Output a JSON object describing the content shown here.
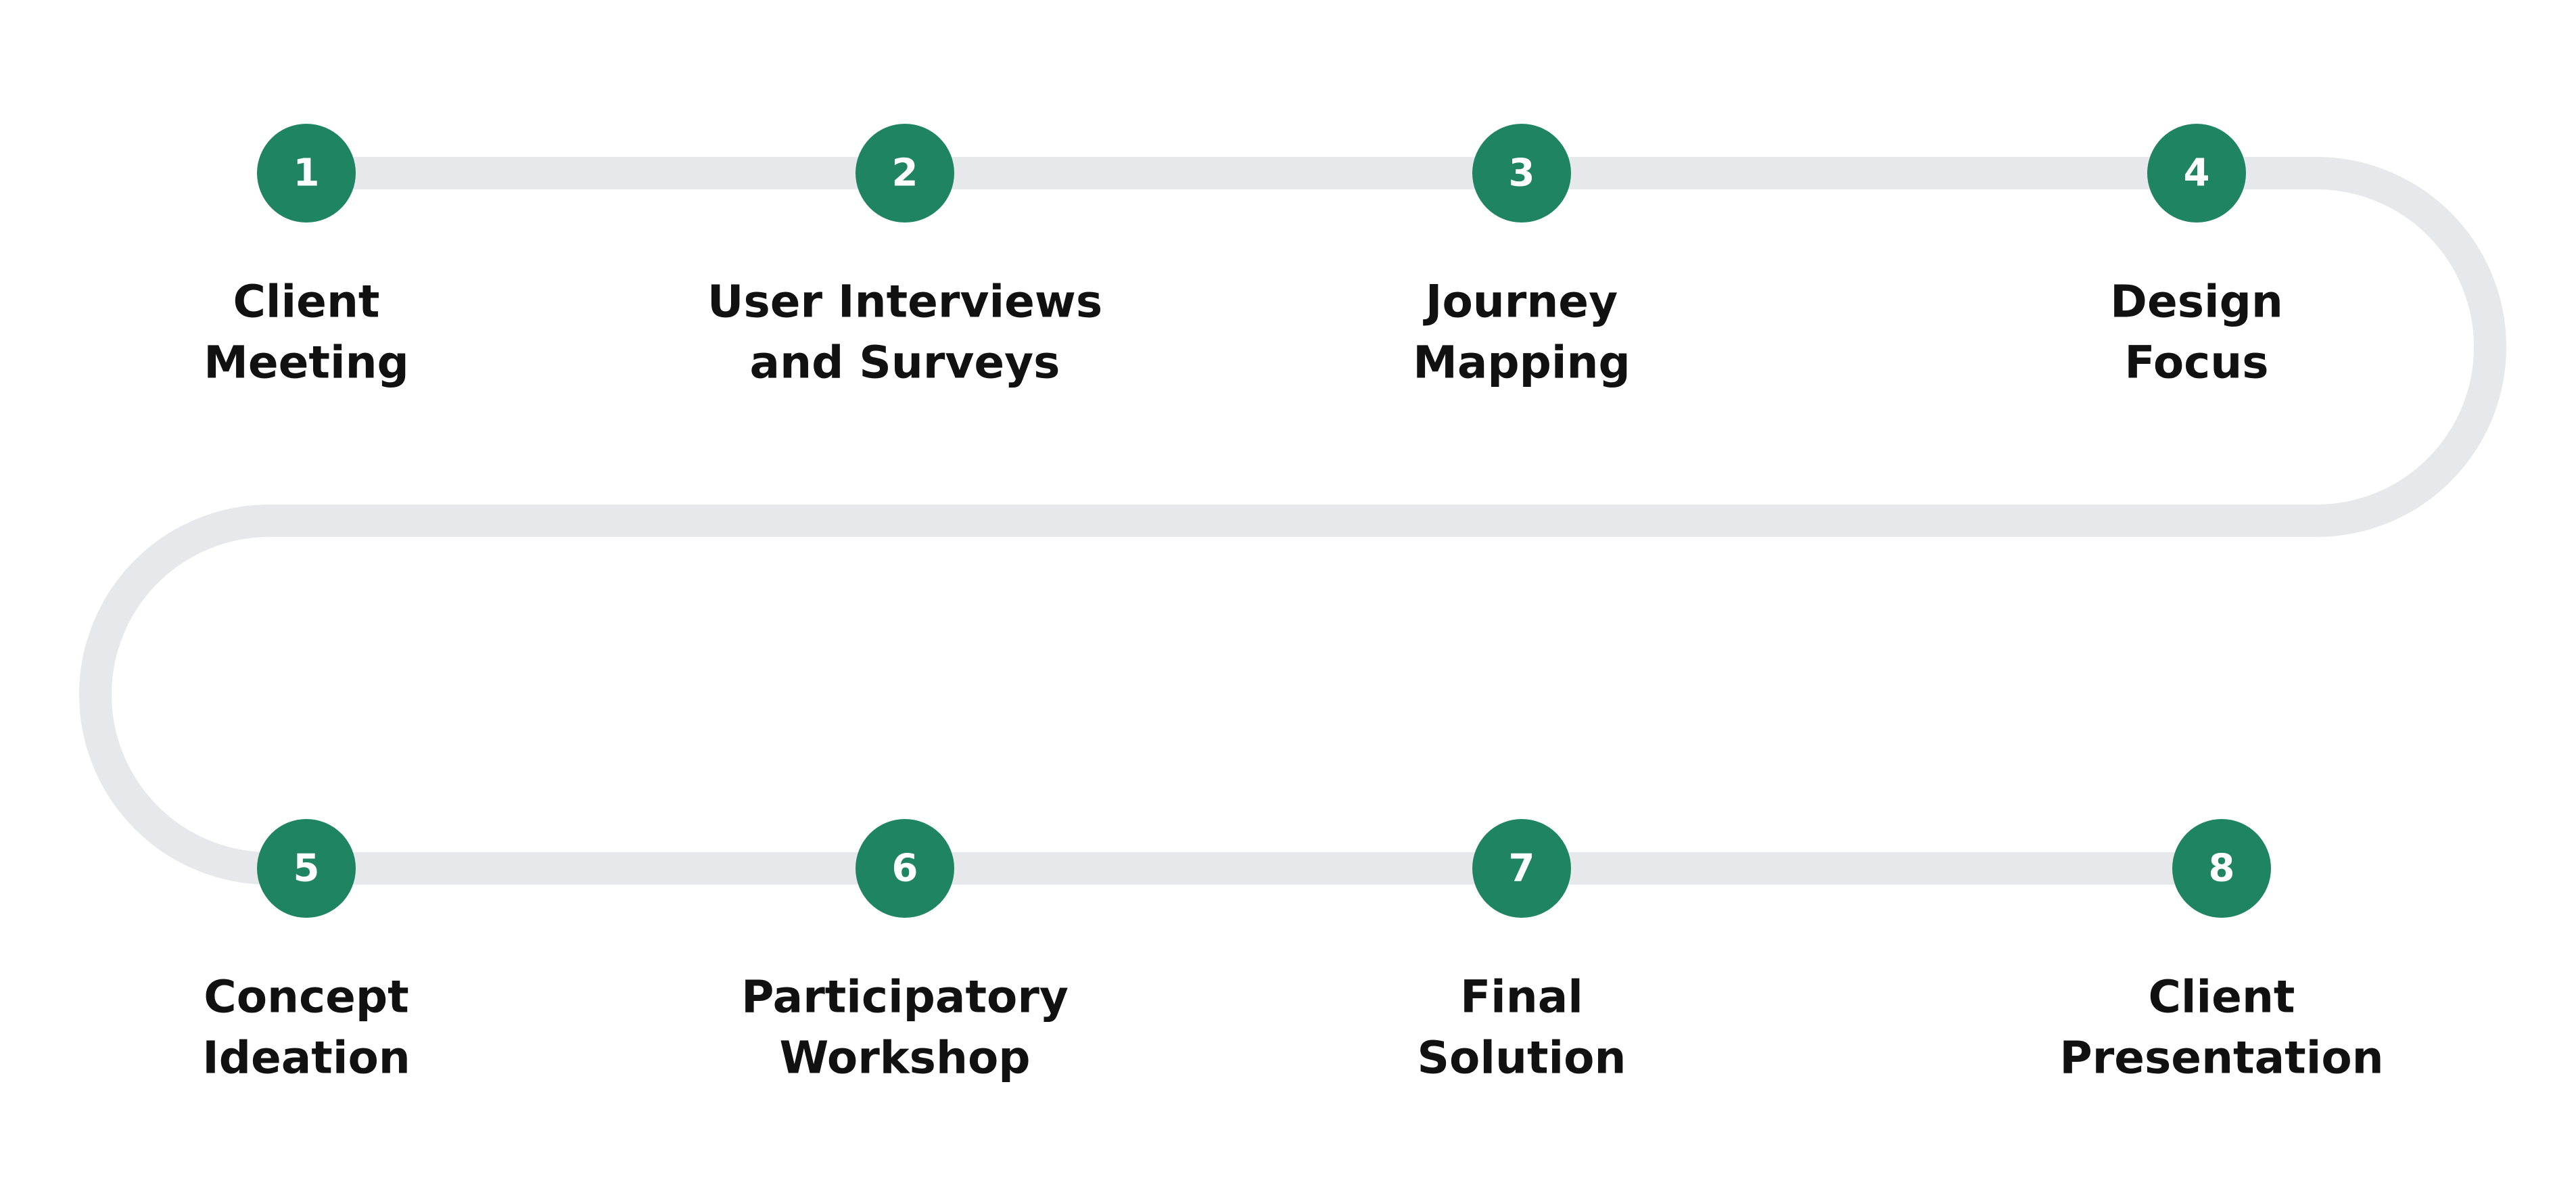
{
  "colors": {
    "track": "#e7e8eb",
    "circle": "#1e8462",
    "number": "#ffffff",
    "label": "#111111",
    "background": "#ffffff"
  },
  "steps": [
    {
      "number": "1",
      "lines": [
        "Client",
        "Meeting"
      ]
    },
    {
      "number": "2",
      "lines": [
        "User Interviews",
        "and Surveys"
      ]
    },
    {
      "number": "3",
      "lines": [
        "Journey",
        "Mapping"
      ]
    },
    {
      "number": "4",
      "lines": [
        "Design",
        "Focus"
      ]
    },
    {
      "number": "5",
      "lines": [
        "Concept",
        "Ideation"
      ]
    },
    {
      "number": "6",
      "lines": [
        "Participatory",
        "Workshop"
      ]
    },
    {
      "number": "7",
      "lines": [
        "Final",
        "Solution"
      ]
    },
    {
      "number": "8",
      "lines": [
        "Client",
        "Presentation"
      ]
    }
  ]
}
